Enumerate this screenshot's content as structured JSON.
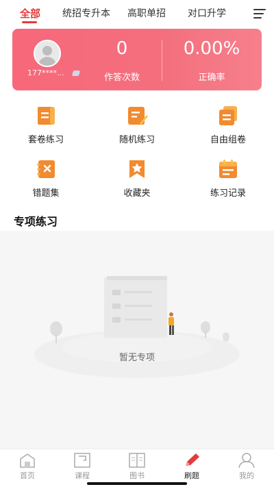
{
  "tabs": [
    {
      "label": "全部",
      "active": true
    },
    {
      "label": "统招专升本",
      "active": false
    },
    {
      "label": "高职单招",
      "active": false
    },
    {
      "label": "对口升学",
      "active": false
    }
  ],
  "icons": {
    "menu": "menu-lines-icon"
  },
  "profile": {
    "phone": "177****...",
    "avatar_icon": "default-avatar-icon",
    "badge_icon": "vip-badge-icon"
  },
  "stats": {
    "answer_count": "0",
    "answer_count_label": "作答次数",
    "accuracy": "0.00%",
    "accuracy_label": "正确率"
  },
  "grid": [
    {
      "label": "套卷练习",
      "icon": "scroll-paper-icon"
    },
    {
      "label": "随机练习",
      "icon": "edit-note-icon"
    },
    {
      "label": "自由组卷",
      "icon": "stacked-papers-icon"
    },
    {
      "label": "错题集",
      "icon": "wrong-notebook-icon"
    },
    {
      "label": "收藏夹",
      "icon": "star-bookmark-icon"
    },
    {
      "label": "练习记录",
      "icon": "record-calendar-icon"
    }
  ],
  "section": {
    "title": "专项练习"
  },
  "empty": {
    "text": "暂无专项"
  },
  "bottom_nav": [
    {
      "label": "首页",
      "icon": "home-icon",
      "active": false
    },
    {
      "label": "课程",
      "icon": "course-icon",
      "active": false
    },
    {
      "label": "图书",
      "icon": "book-icon",
      "active": false
    },
    {
      "label": "刷题",
      "icon": "pencil-icon",
      "active": true
    },
    {
      "label": "我的",
      "icon": "profile-icon",
      "active": false
    }
  ],
  "colors": {
    "accent": "#e33b3b",
    "card_start": "#f7687a",
    "card_end": "#f6808c",
    "icon_orange": "#f28a2f"
  }
}
